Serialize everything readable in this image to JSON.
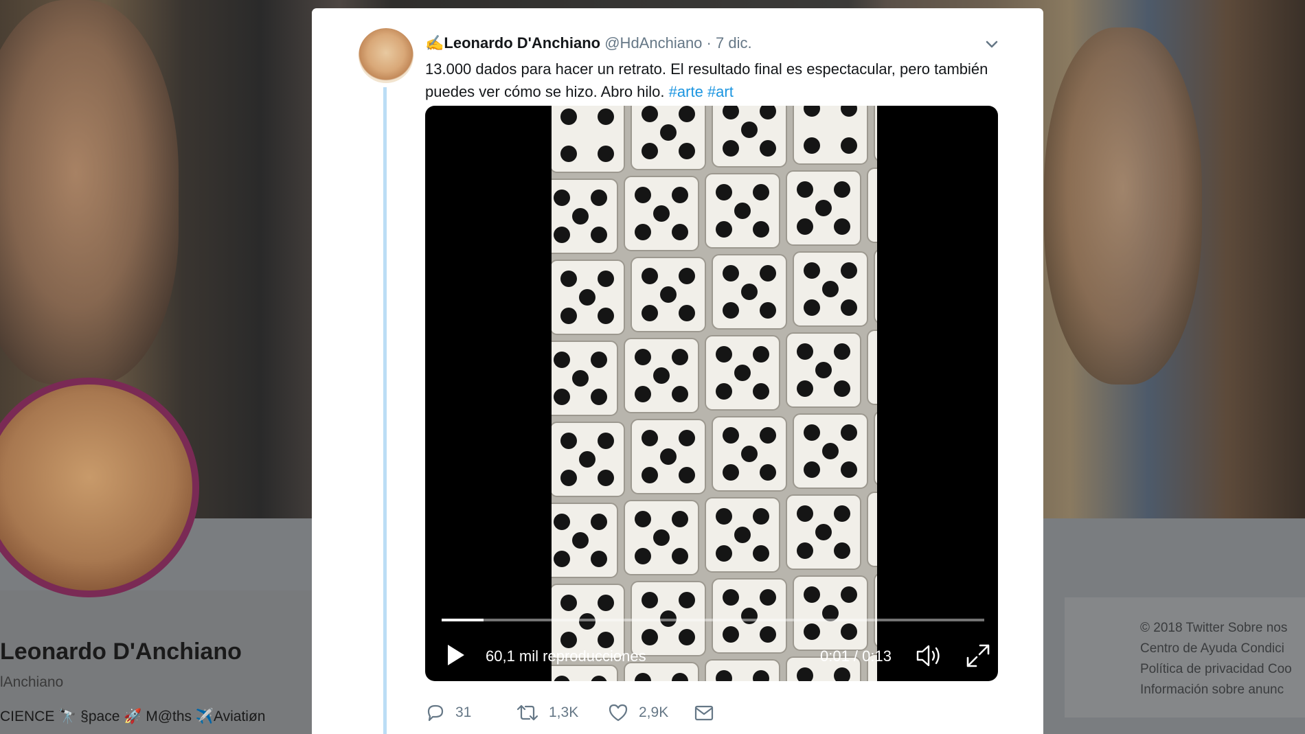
{
  "background": {
    "profile_name": "Leonardo D'Anchiano",
    "profile_handle": "lAnchiano",
    "profile_bio": "CIENCE 🔭 §pace 🚀 M@ths ✈️Aviatiøn",
    "footer": [
      "© 2018 Twitter   Sobre nos",
      "Centro de Ayuda   Condici",
      "Política de privacidad   Coo",
      "Información sobre anunc"
    ]
  },
  "tweet": {
    "author_emoji": "✍️",
    "author_name": "Leonardo D'Anchiano",
    "author_handle": "@HdAnchiano",
    "date": "· 7 dic.",
    "text_main": "13.000 dados para hacer un retrato. El resultado final es espectacular, pero también puedes ver cómo se hizo. Abro hilo.",
    "hashtags": [
      "#arte",
      "#art"
    ],
    "video": {
      "views": "60,1 mil reproducciones",
      "time": "0:01 / 0:13",
      "progress": 0.077
    },
    "actions": {
      "replies": "31",
      "retweets": "1,3K",
      "likes": "2,9K"
    }
  },
  "icons": [
    "chevron-down-icon",
    "play-icon",
    "volume-icon",
    "fullscreen-icon",
    "reply-icon",
    "retweet-icon",
    "like-icon",
    "message-icon"
  ],
  "colors": {
    "link": "#1b95e0",
    "text": "#14171a",
    "muted": "#657786",
    "thread": "#bbddf5"
  }
}
